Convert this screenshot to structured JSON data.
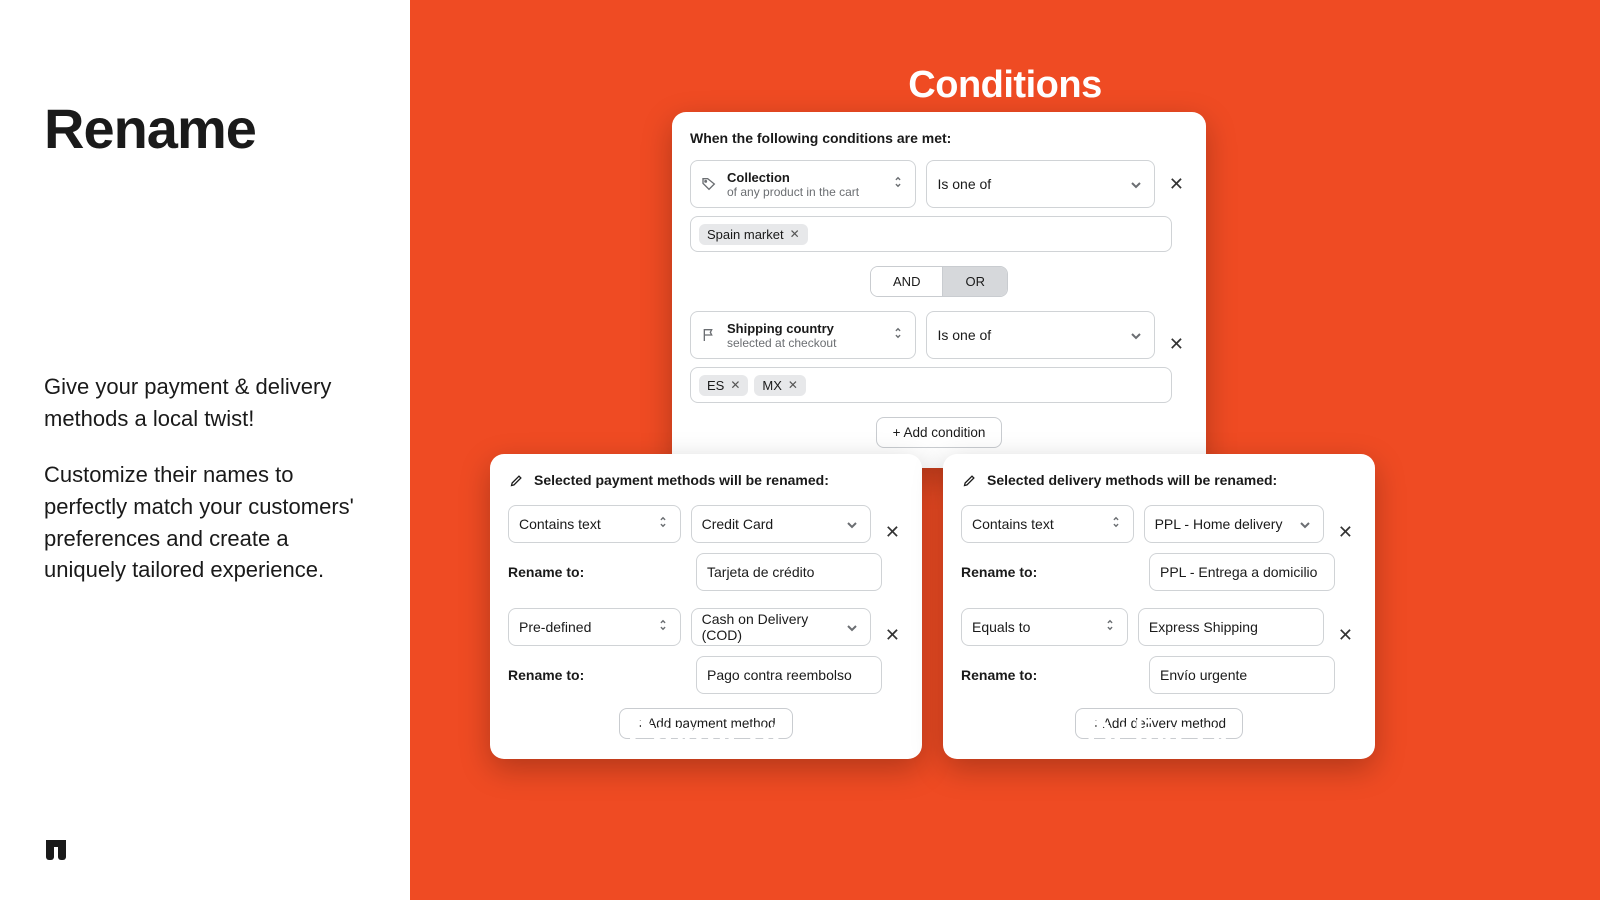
{
  "left": {
    "heading": "Rename",
    "desc1": "Give your payment & delivery methods a local twist!",
    "desc2": "Customize their names to perfectly match your customers' preferences and create a uniquely tailored experience."
  },
  "titles": {
    "conditions": "Conditions",
    "payment": "Payment",
    "delivery": "Delivery"
  },
  "conditions": {
    "intro": "When the following conditions are met:",
    "row1": {
      "attr": "Collection",
      "attr_sub": "of any product in the cart",
      "op": "Is one of"
    },
    "chips1": [
      {
        "label": "Spain market"
      }
    ],
    "logic": {
      "and": "AND",
      "or": "OR",
      "active": "or"
    },
    "row2": {
      "attr": "Shipping country",
      "attr_sub": "selected at checkout",
      "op": "Is one of"
    },
    "chips2": [
      {
        "label": "ES"
      },
      {
        "label": "MX"
      }
    ],
    "add_btn": "+ Add condition"
  },
  "payment": {
    "header": "Selected payment methods will be renamed:",
    "rows": [
      {
        "match": "Contains text",
        "value": "Credit Card",
        "rename_label": "Rename to:",
        "rename_value": "Tarjeta de crédito",
        "match_kind": "select",
        "value_kind": "select"
      },
      {
        "match": "Pre-defined",
        "value": "Cash on Delivery (COD)",
        "rename_label": "Rename to:",
        "rename_value": "Pago contra reembolso",
        "match_kind": "select",
        "value_kind": "select"
      }
    ],
    "add_btn": "+ Add payment method"
  },
  "delivery": {
    "header": "Selected delivery methods will be renamed:",
    "rows": [
      {
        "match": "Contains text",
        "value": "PPL - Home delivery",
        "rename_label": "Rename to:",
        "rename_value": "PPL - Entrega a domicilio",
        "match_kind": "select",
        "value_kind": "select"
      },
      {
        "match": "Equals to",
        "value": "Express Shipping",
        "rename_label": "Rename to:",
        "rename_value": "Envío urgente",
        "match_kind": "select",
        "value_kind": "input"
      }
    ],
    "add_btn": "+ Add delivery method"
  }
}
